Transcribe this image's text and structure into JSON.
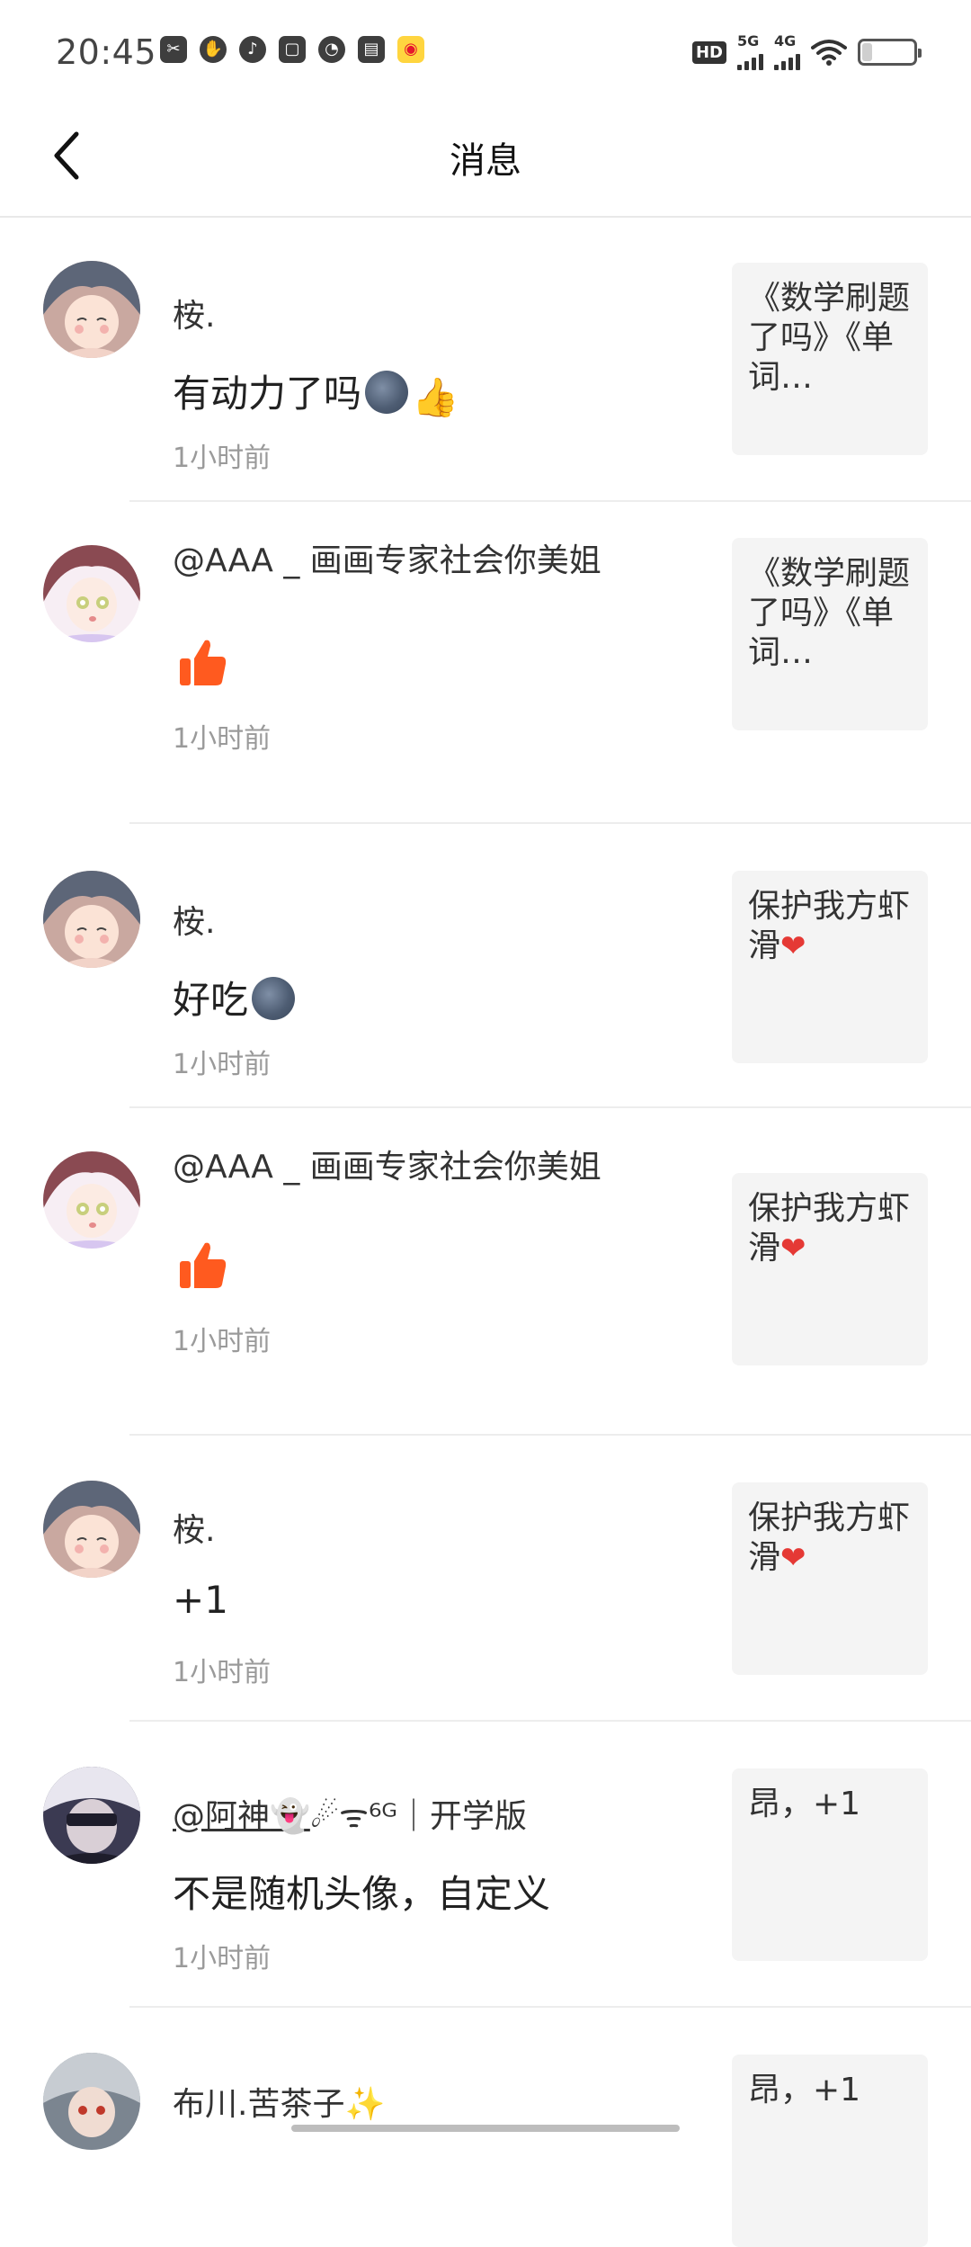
{
  "status_bar": {
    "time": "20:45",
    "left_icons": [
      "scissors-app-icon",
      "hand-app-icon",
      "audio-app-icon",
      "bag-app-icon",
      "gauge-app-icon",
      "book-app-icon",
      "weibo-app-icon"
    ],
    "hd_label": "HD",
    "sim1_label": "5G",
    "sim2_label": "4G",
    "battery_level": "4"
  },
  "header": {
    "title": "消息",
    "back_icon": "chevron-left-icon"
  },
  "messages": [
    {
      "username": "桉.",
      "content": "有动力了吗",
      "content_emojis": [
        "moon-face",
        "thumbs-up"
      ],
      "time": "1小时前",
      "preview": "《数学刷题了吗》《单词…"
    },
    {
      "username": "@AAA _ 画画专家社会你美姐",
      "content": "",
      "content_emojis": [
        "orange-like"
      ],
      "time": "1小时前",
      "preview": "《数学刷题了吗》《单词…"
    },
    {
      "username": "桉.",
      "content": "好吃",
      "content_emojis": [
        "moon-face"
      ],
      "time": "1小时前",
      "preview": "保护我方虾滑"
    },
    {
      "username": "@AAA _ 画画专家社会你美姐",
      "content": "",
      "content_emojis": [
        "orange-like"
      ],
      "time": "1小时前",
      "preview": "保护我方虾滑"
    },
    {
      "username": "桉.",
      "content": "+1",
      "content_emojis": [],
      "time": "1小时前",
      "preview": "保护我方虾滑"
    },
    {
      "username": "@阿神",
      "username_suffix": "☄ᯤ⁶ᴳ｜开学版",
      "content": "不是随机头像，自定义",
      "content_emojis": [],
      "time": "1小时前",
      "preview": "昂，+1"
    },
    {
      "username": "布川.苦茶子",
      "content": "",
      "content_emojis": [],
      "time": "",
      "preview": "昂，+1"
    }
  ],
  "colors": {
    "like_orange": "#ff5a1f",
    "preview_bg": "#f4f4f4",
    "timestamp": "#9a9a9a",
    "divider": "#ededed"
  }
}
